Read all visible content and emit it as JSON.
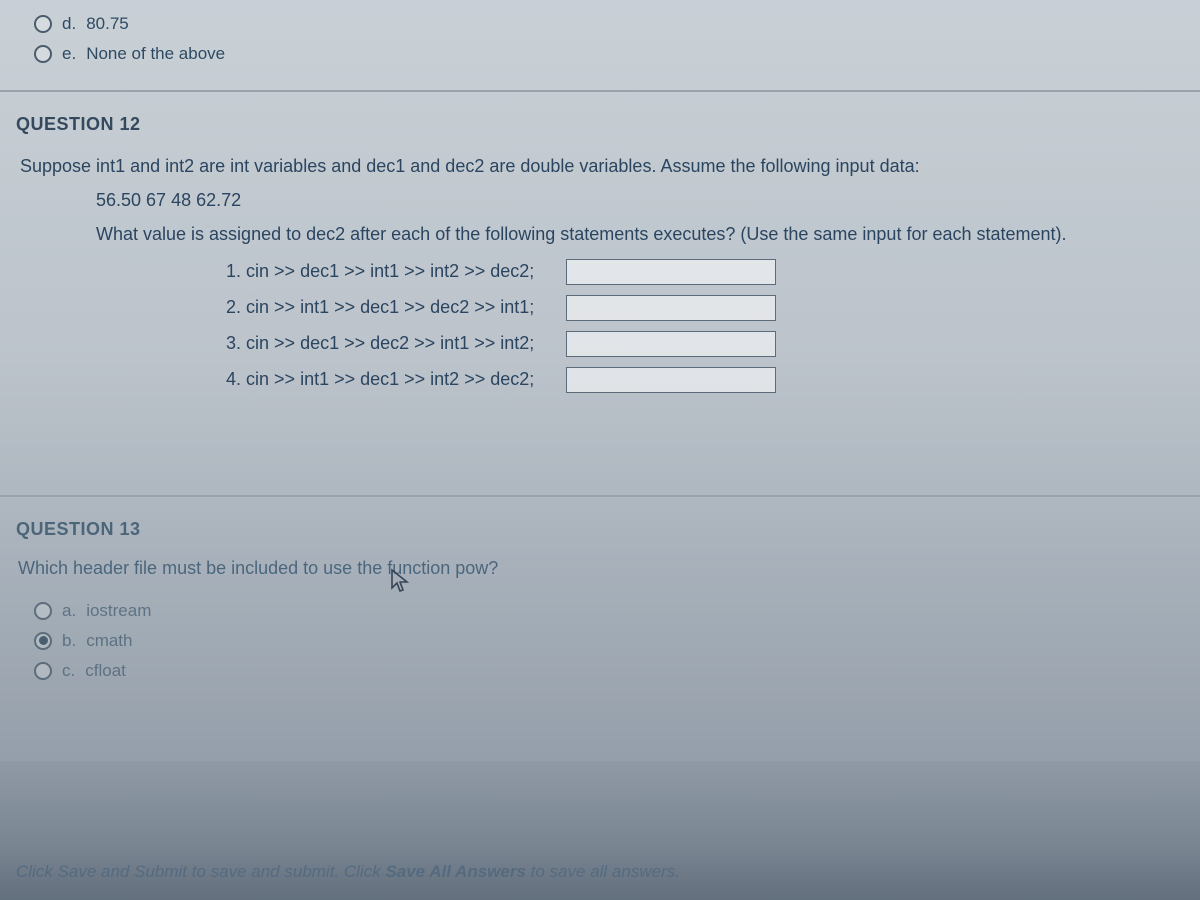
{
  "q11_tail": {
    "options": [
      {
        "letter": "d.",
        "text": "80.75",
        "selected": false
      },
      {
        "letter": "e.",
        "text": "None of the above",
        "selected": false
      }
    ]
  },
  "q12": {
    "title": "QUESTION 12",
    "prompt_line1": "Suppose int1 and int2 are int variables and dec1 and dec2 are double variables. Assume the following input data:",
    "input_data": "56.50 67 48 62.72",
    "prompt_line2": "What value is assigned to dec2 after each of the following statements executes? (Use the same input for each statement).",
    "statements": [
      {
        "n": "1.",
        "code": "cin >> dec1 >> int1 >> int2 >> dec2;"
      },
      {
        "n": "2.",
        "code": "cin >> int1 >> dec1 >> dec2 >> int1;"
      },
      {
        "n": "3.",
        "code": "cin >> dec1 >> dec2 >> int1 >> int2;"
      },
      {
        "n": "4.",
        "code": "cin >> int1 >> dec1 >> int2 >> dec2;"
      }
    ]
  },
  "q13": {
    "title": "QUESTION 13",
    "prompt": "Which header file must be included to use the function pow?",
    "options": [
      {
        "letter": "a.",
        "text": "iostream",
        "selected": false
      },
      {
        "letter": "b.",
        "text": "cmath",
        "selected": true
      },
      {
        "letter": "c.",
        "text": "cfloat",
        "selected": false
      }
    ]
  },
  "footer": {
    "part1": "Click Save and Submit to save and submit. Click ",
    "em": "Save All Answers",
    "part2": " to save all answers."
  }
}
